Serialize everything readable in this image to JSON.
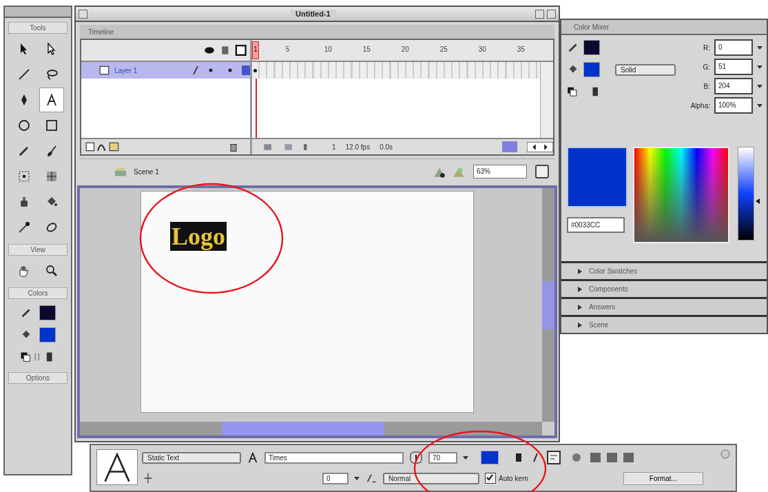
{
  "tools_panel": {
    "title": "Tools",
    "tools": [
      {
        "kind": "arrow",
        "selected": false
      },
      {
        "kind": "subselect",
        "selected": false
      },
      {
        "kind": "line",
        "selected": false
      },
      {
        "kind": "lasso",
        "selected": false
      },
      {
        "kind": "pen",
        "selected": false
      },
      {
        "kind": "text",
        "selected": true
      },
      {
        "kind": "oval",
        "selected": false
      },
      {
        "kind": "rectangle",
        "selected": false
      },
      {
        "kind": "pencil",
        "selected": false
      },
      {
        "kind": "brush",
        "selected": false
      },
      {
        "kind": "free_transform",
        "selected": false
      },
      {
        "kind": "fill_transform",
        "selected": false
      },
      {
        "kind": "ink_bottle",
        "selected": false
      },
      {
        "kind": "paint_bucket",
        "selected": false
      },
      {
        "kind": "eyedropper",
        "selected": false
      },
      {
        "kind": "eraser",
        "selected": false
      }
    ],
    "view_title": "View",
    "view_tools": [
      {
        "kind": "hand",
        "selected": false
      },
      {
        "kind": "zoom",
        "selected": false
      }
    ],
    "colors_title": "Colors",
    "options_title": "Options"
  },
  "document": {
    "title": "Untitled-1",
    "timeline": {
      "title": "Timeline",
      "layers": [
        {
          "name": "Layer 1",
          "selected": true
        }
      ],
      "frame_numbers": [
        "1",
        "5",
        "10",
        "15",
        "20",
        "25",
        "30",
        "35"
      ],
      "current_frame": "1",
      "frame_rate": "12.0 fps",
      "elapsed_time": "0.0s"
    },
    "scene": "Scene 1",
    "zoom": "63%",
    "stage": {
      "logo": "Logo",
      "logo_circled": true
    }
  },
  "color_mixer": {
    "title": "Color Mixer",
    "fill_type": "Solid",
    "channels": [
      {
        "label": "R:",
        "value": "0"
      },
      {
        "label": "G:",
        "value": "51"
      },
      {
        "label": "B:",
        "value": "204"
      },
      {
        "label": "Alpha:",
        "value": "100%"
      }
    ],
    "hex": "#0033CC",
    "brightness": {
      "level": 0.42
    }
  },
  "collapsed_panels": [
    {
      "title": "Color Swatches",
      "expanded": false
    },
    {
      "title": "Components",
      "expanded": false
    },
    {
      "title": "Answers",
      "expanded": false
    },
    {
      "title": "Scene",
      "expanded": false
    }
  ],
  "properties": {
    "text_type": "Static Text",
    "font": "Times",
    "font_size": "70",
    "character_spacing": "0",
    "character_position": "Normal",
    "auto_kern": true,
    "auto_kern_label": "Auto kern",
    "format_button": "Format...",
    "circled": true
  }
}
